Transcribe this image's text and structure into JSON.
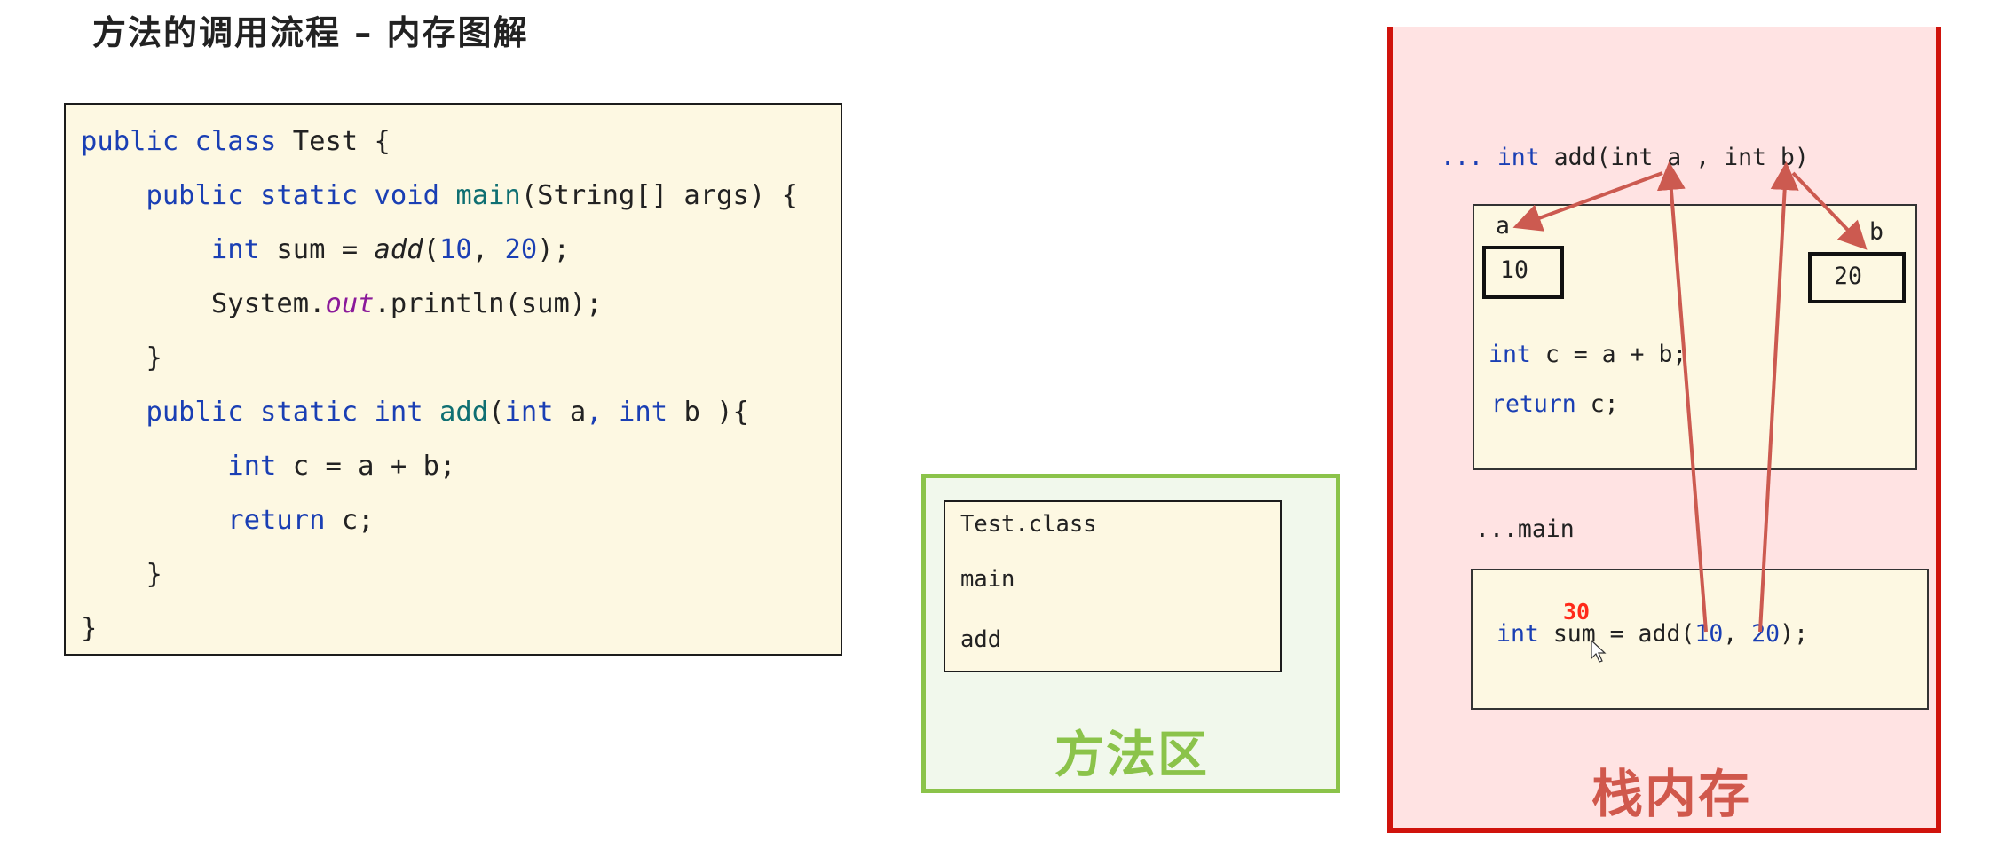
{
  "title": "方法的调用流程 – 内存图解",
  "source_code": {
    "lines": [
      [
        {
          "t": "public class ",
          "c": "kw"
        },
        {
          "t": "Test {",
          "c": ""
        }
      ],
      [
        {
          "t": "    public static void ",
          "c": "kw"
        },
        {
          "t": "main",
          "c": "fn"
        },
        {
          "t": "(String[] args) {",
          "c": ""
        }
      ],
      [
        {
          "t": "        int ",
          "c": "kw"
        },
        {
          "t": "sum = ",
          "c": ""
        },
        {
          "t": "add",
          "c": "it"
        },
        {
          "t": "(",
          "c": ""
        },
        {
          "t": "10",
          "c": "num"
        },
        {
          "t": ", ",
          "c": ""
        },
        {
          "t": "20",
          "c": "num"
        },
        {
          "t": ");",
          "c": ""
        }
      ],
      [
        {
          "t": "        System.",
          "c": ""
        },
        {
          "t": "out",
          "c": "fld"
        },
        {
          "t": ".println(sum);",
          "c": ""
        }
      ],
      [
        {
          "t": "    }",
          "c": ""
        }
      ],
      [
        {
          "t": "    public static int ",
          "c": "kw"
        },
        {
          "t": "add",
          "c": "fn"
        },
        {
          "t": "(",
          "c": ""
        },
        {
          "t": "int ",
          "c": "kw"
        },
        {
          "t": "a",
          "c": ""
        },
        {
          "t": ", ",
          "c": "kw"
        },
        {
          "t": "int ",
          "c": "kw"
        },
        {
          "t": "b ){",
          "c": ""
        }
      ],
      [
        {
          "t": "         int ",
          "c": "kw"
        },
        {
          "t": "c = a + b;",
          "c": ""
        }
      ],
      [
        {
          "t": "         return ",
          "c": "kw"
        },
        {
          "t": "c;",
          "c": ""
        }
      ],
      [
        {
          "t": "    }",
          "c": ""
        }
      ],
      [
        {
          "t": "}",
          "c": ""
        }
      ]
    ]
  },
  "method_area": {
    "label": "方法区",
    "items": [
      "Test.class",
      "main",
      "add"
    ]
  },
  "stack": {
    "label": "栈内存",
    "add_frame": {
      "signature_prefix": "... ",
      "signature_kw": "int",
      "signature_rest": " add(int a , int b)",
      "var_a": {
        "name": "a",
        "value": "10"
      },
      "var_b": {
        "name": "b",
        "value": "20"
      },
      "line1_kw": "int",
      "line1_rest": " c = a + b;",
      "line2_kw": "return",
      "line2_rest": " c;"
    },
    "main_frame": {
      "label": "...main",
      "result": "30",
      "code_kw": "int",
      "code_pre": " sum = add(",
      "arg1": "10",
      "sep": ", ",
      "arg2": "20",
      "code_post": ");"
    }
  },
  "colors": {
    "keyword": "#1a3fb4",
    "method_area_green": "#8bc34a",
    "stack_red": "#d0130c",
    "arrow": "#cc5a50",
    "result": "#ff2a1a"
  }
}
